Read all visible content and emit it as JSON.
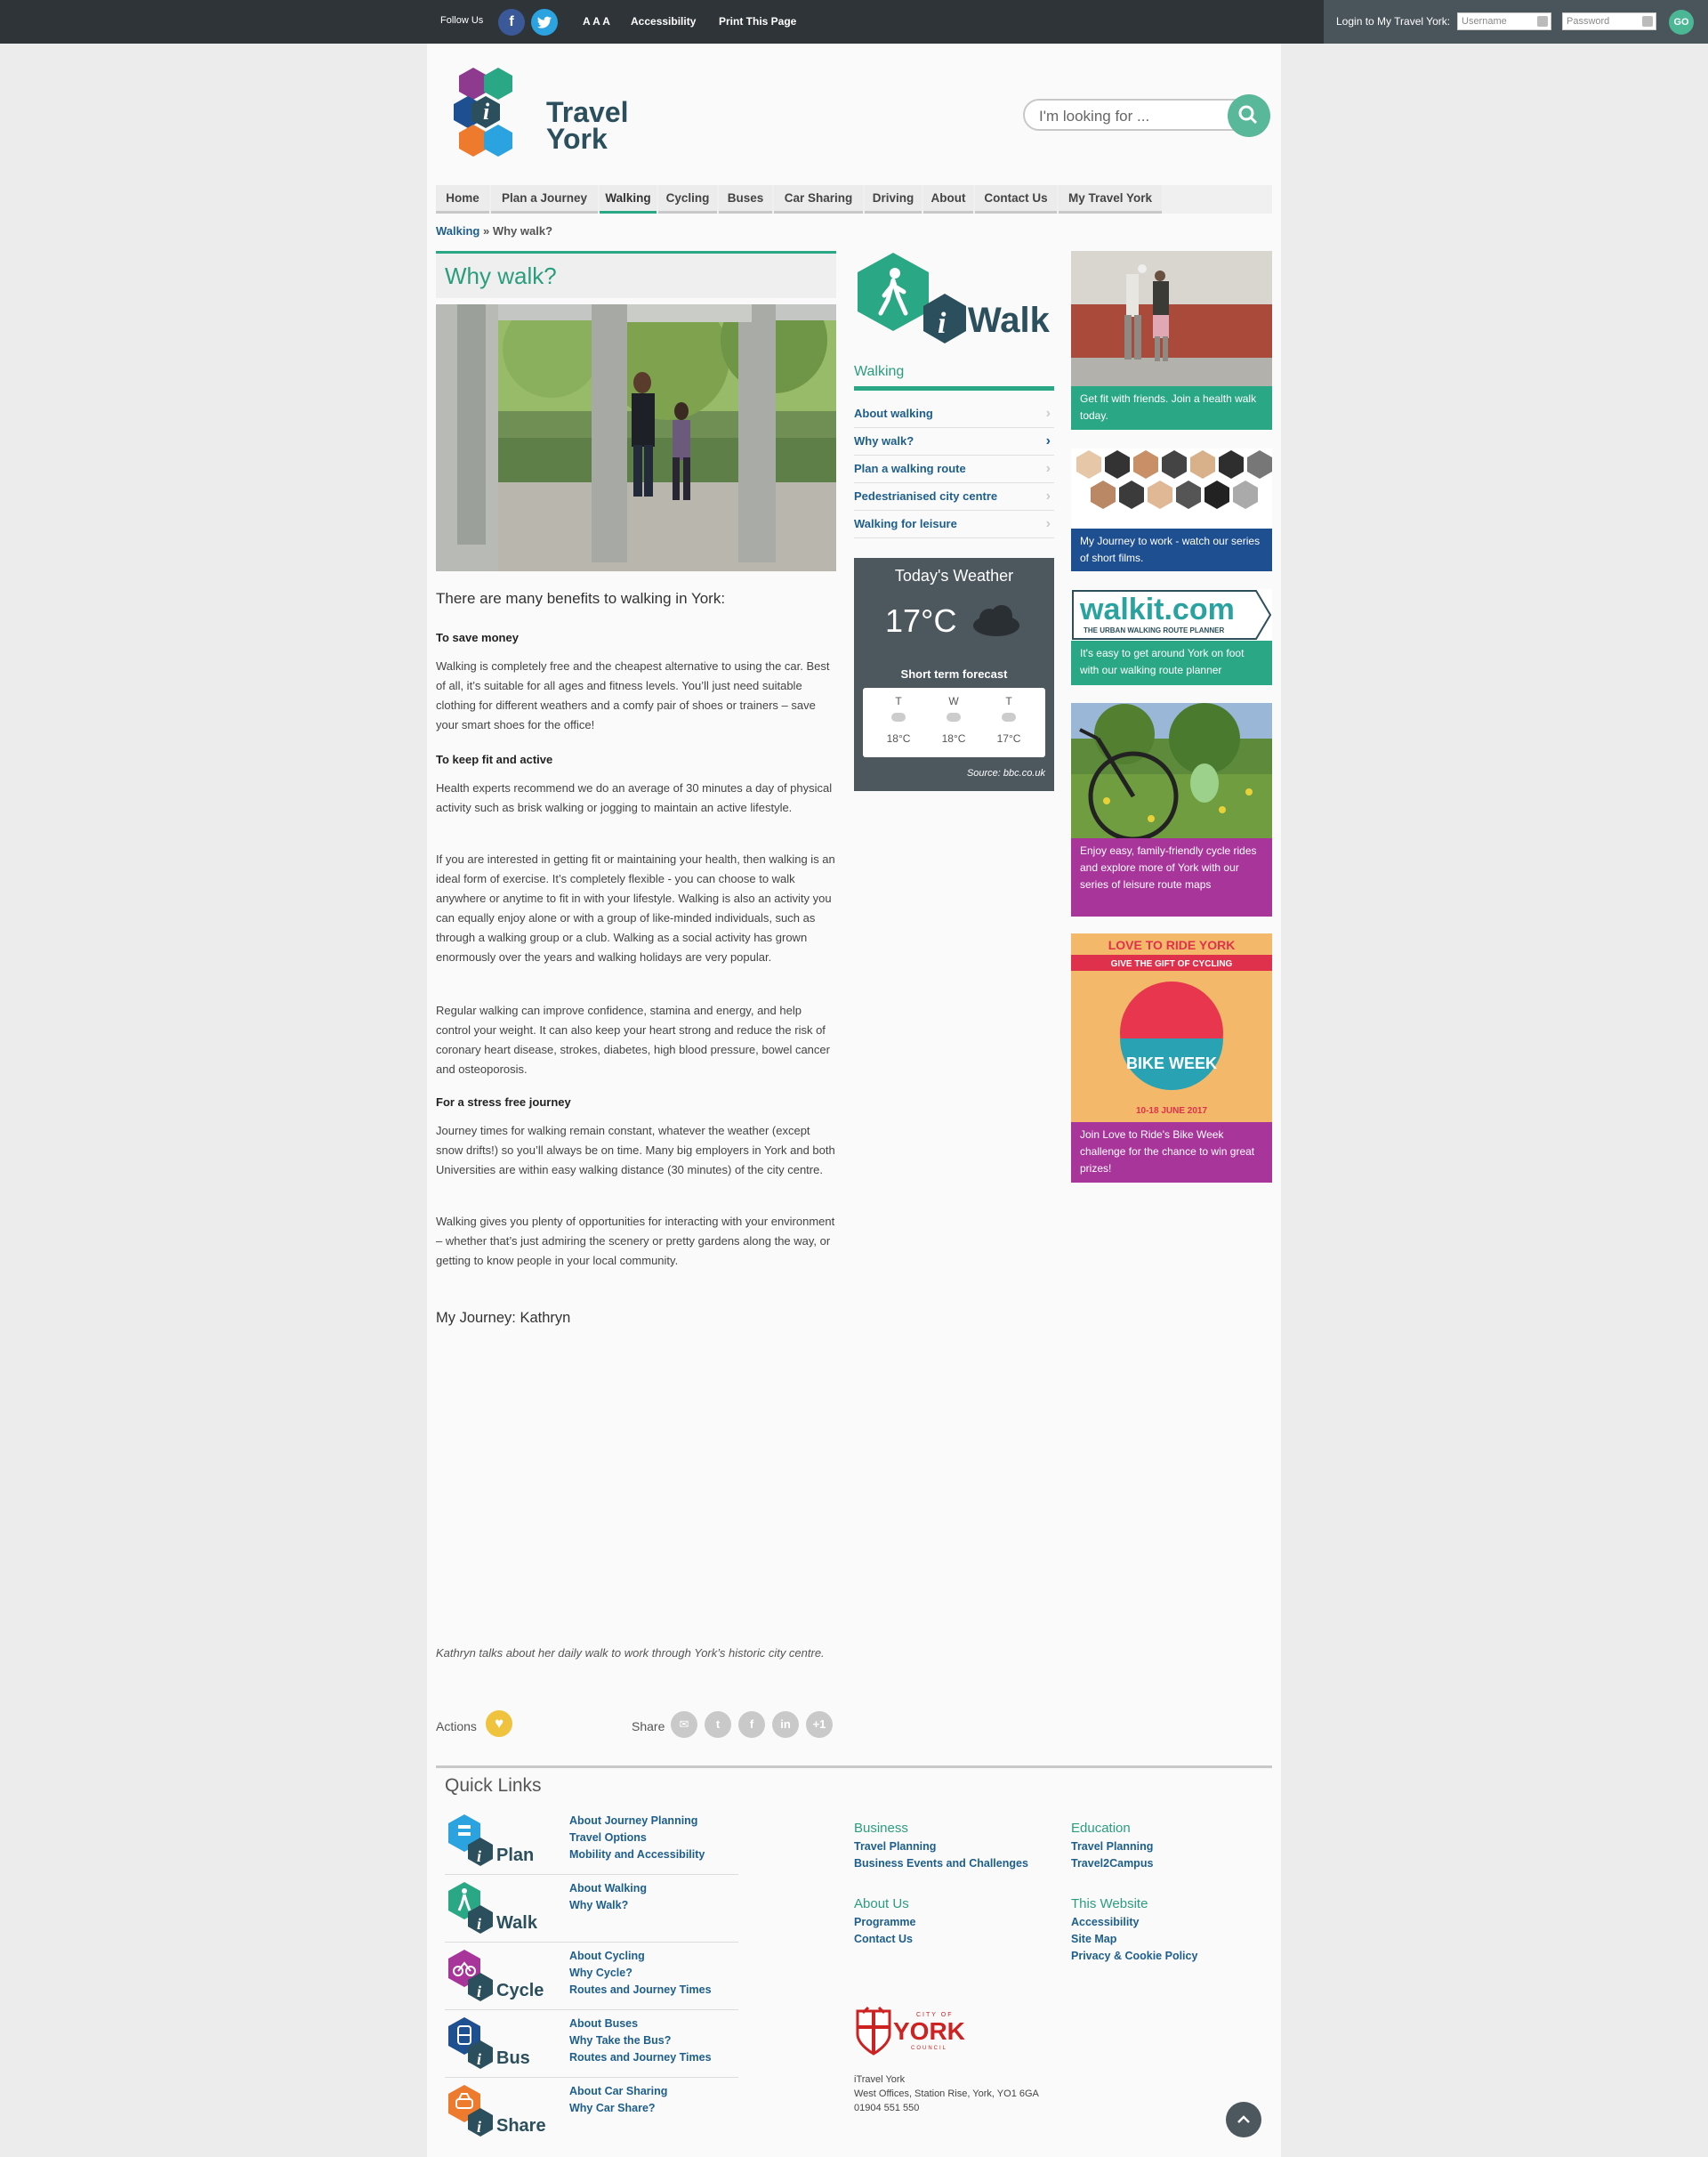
{
  "topbar": {
    "follow_us": "Follow Us",
    "text_size": "A A A",
    "accessibility": "Accessibility",
    "print": "Print This Page",
    "login_label": "Login to My Travel York:",
    "username_placeholder": "Username",
    "password_placeholder": "Password",
    "go": "GO"
  },
  "logo": {
    "line1": "Travel",
    "line2": "York"
  },
  "search": {
    "placeholder": "I'm looking for ..."
  },
  "nav": [
    {
      "label": "Home"
    },
    {
      "label": "Plan a Journey"
    },
    {
      "label": "Walking"
    },
    {
      "label": "Cycling"
    },
    {
      "label": "Buses"
    },
    {
      "label": "Car Sharing"
    },
    {
      "label": "Driving"
    },
    {
      "label": "About"
    },
    {
      "label": "Contact Us"
    },
    {
      "label": "My Travel York"
    }
  ],
  "breadcrumb": {
    "parent": "Walking",
    "sep": " » ",
    "current": "Why walk?"
  },
  "article": {
    "title": "Why walk?",
    "intro": "There are many benefits to walking in York:",
    "h_money": "To save money",
    "p_money": "Walking is completely free and the cheapest alternative to using the car. Best of all, it’s suitable for all ages and fitness levels. You’ll just need suitable clothing for different weathers and a comfy pair of shoes or trainers – save your smart shoes for the office!",
    "h_fit": "To keep fit and active",
    "p_fit1": "Health experts recommend we do an average of 30 minutes a day of physical activity such as brisk walking or jogging to maintain an active lifestyle.",
    "p_fit2": "If you are interested in getting fit or maintaining your health, then walking is an ideal form of exercise. It’s completely flexible - you can choose to walk anywhere or anytime to fit in with your lifestyle. Walking is also  an activity you can equally enjoy alone or with a group of like-minded individuals, such as  through a walking group or a club. Walking as a social activity has grown enormously over the years and walking holidays are very popular.",
    "p_fit3": "Regular walking can improve confidence, stamina and energy, and help control your weight. It can also keep your heart strong and reduce the risk of coronary heart disease, strokes, diabetes, high blood pressure, bowel cancer and osteoporosis.",
    "h_stress": "For a stress free journey",
    "p_stress1": "Journey times for walking remain constant, whatever the weather (except snow drifts!) so you’ll always be on time. Many big employers in York and both Universities are within easy walking distance (30 minutes) of the city centre.",
    "p_stress2": "Walking gives you plenty of opportunities for interacting with your environment – whether that’s just admiring the scenery or pretty gardens along the way, or getting to know people in your local community.",
    "my_journey": "My Journey: Kathryn",
    "caption": "Kathryn talks about her daily walk to work through York’s historic city centre.",
    "actions": "Actions",
    "share": "Share"
  },
  "sidebar": {
    "logo_text": "Walk",
    "heading": "Walking",
    "items": [
      {
        "label": "About walking"
      },
      {
        "label": "Why walk?"
      },
      {
        "label": "Plan a walking route"
      },
      {
        "label": "Pedestrianised city centre"
      },
      {
        "label": "Walking for leisure"
      }
    ]
  },
  "weather": {
    "title": "Today's Weather",
    "temp": "17°C",
    "forecast_label": "Short term forecast",
    "days": [
      {
        "day": "T",
        "temp": "18°C"
      },
      {
        "day": "W",
        "temp": "18°C"
      },
      {
        "day": "T",
        "temp": "17°C"
      }
    ],
    "source": "Source: bbc.co.uk"
  },
  "promos": {
    "p1": "Get fit with friends.  Join a health walk today.",
    "p2": "My Journey to work - watch our series of short films.",
    "p3": "It's easy to get around York on foot with our walking route planner",
    "p3_logo": "walkit.com",
    "p3_tagline": "THE URBAN WALKING ROUTE PLANNER",
    "p4": "Enjoy easy, family-friendly cycle rides and explore more of York with our series of leisure route maps",
    "p5": "Join Love to Ride's Bike Week challenge for the chance to win great prizes!",
    "p5_title": "LOVE TO RIDE YORK",
    "p5_sub": "GIVE THE GIFT OF CYCLING",
    "p5_week": "BIKE WEEK",
    "p5_dates": "10-18 JUNE 2017"
  },
  "quicklinks": {
    "title": "Quick Links",
    "rows": [
      {
        "logo": "Plan",
        "links": [
          "About Journey Planning",
          "Travel Options",
          "Mobility and Accessibility"
        ]
      },
      {
        "logo": "Walk",
        "links": [
          "About Walking",
          "Why Walk?"
        ]
      },
      {
        "logo": "Cycle",
        "links": [
          "About Cycling",
          "Why Cycle?",
          "Routes and Journey Times"
        ]
      },
      {
        "logo": "Bus",
        "links": [
          "About Buses",
          "Why Take the Bus?",
          "Routes and Journey Times"
        ]
      },
      {
        "logo": "Share",
        "links": [
          "About Car Sharing",
          "Why Car Share?"
        ]
      }
    ]
  },
  "footer": {
    "business": {
      "title": "Business",
      "links": [
        "Travel Planning",
        "Business Events and Challenges"
      ]
    },
    "education": {
      "title": "Education",
      "links": [
        "Travel Planning",
        "Travel2Campus"
      ]
    },
    "about": {
      "title": "About Us",
      "links": [
        "Programme",
        "Contact Us"
      ]
    },
    "site": {
      "title": "This Website",
      "links": [
        "Accessibility",
        "Site Map",
        "Privacy & Cookie Policy"
      ]
    },
    "york_small": "CITY OF",
    "york": "YORK",
    "york_council": "COUNCIL",
    "address1": "iTravel York",
    "address2": "West Offices, Station Rise, York, YO1 6GA",
    "phone": "01904 551 550"
  }
}
